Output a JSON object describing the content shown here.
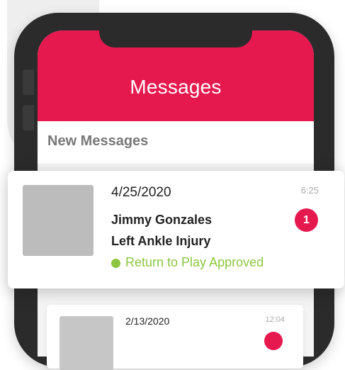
{
  "header": {
    "title": "Messages"
  },
  "section": {
    "title": "New Messages"
  },
  "messages": [
    {
      "date": "4/25/2020",
      "time": "6:25",
      "sender": "Jimmy Gonzales",
      "subject": "Left Ankle Injury",
      "unread_count": "1",
      "status": "Return to Play Approved"
    },
    {
      "date": "2/13/2020",
      "time": "12:04"
    }
  ],
  "colors": {
    "accent": "#e6194f",
    "status_green": "#8cc63f",
    "phone_frame": "#2b2b2b"
  }
}
